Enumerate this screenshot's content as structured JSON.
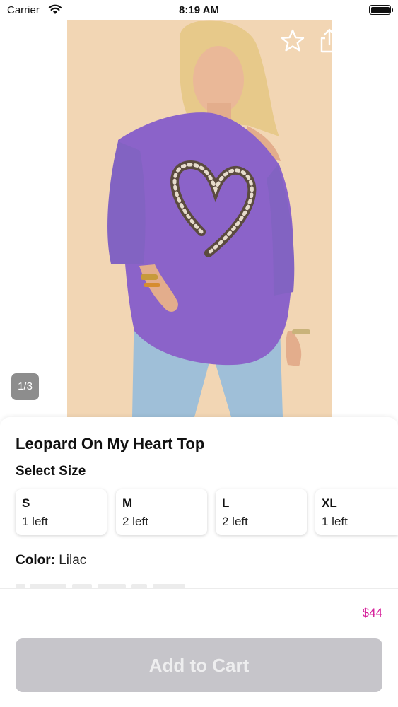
{
  "status_bar": {
    "carrier": "Carrier",
    "time": "8:19 AM"
  },
  "nav": {
    "back_icon": "chevron-left-icon",
    "favorite_icon": "star-icon",
    "share_icon": "share-icon",
    "cart_icon": "cart-icon"
  },
  "gallery": {
    "page_indicator": "1/3"
  },
  "product": {
    "title": "Leopard On My Heart Top",
    "select_size_label": "Select Size",
    "sizes": [
      {
        "name": "S",
        "stock": "1 left"
      },
      {
        "name": "M",
        "stock": "2 left"
      },
      {
        "name": "L",
        "stock": "2 left"
      },
      {
        "name": "XL",
        "stock": "1 left"
      }
    ],
    "color_label": "Color:",
    "color_value": "Lilac"
  },
  "bottom_bar": {
    "price": "$44",
    "add_to_cart_label": "Add to Cart"
  },
  "colors": {
    "price": "#d6219b",
    "button_disabled": "#c6c5ca",
    "image_background": "#f2d6b4",
    "shirt": "#8b63c9"
  }
}
